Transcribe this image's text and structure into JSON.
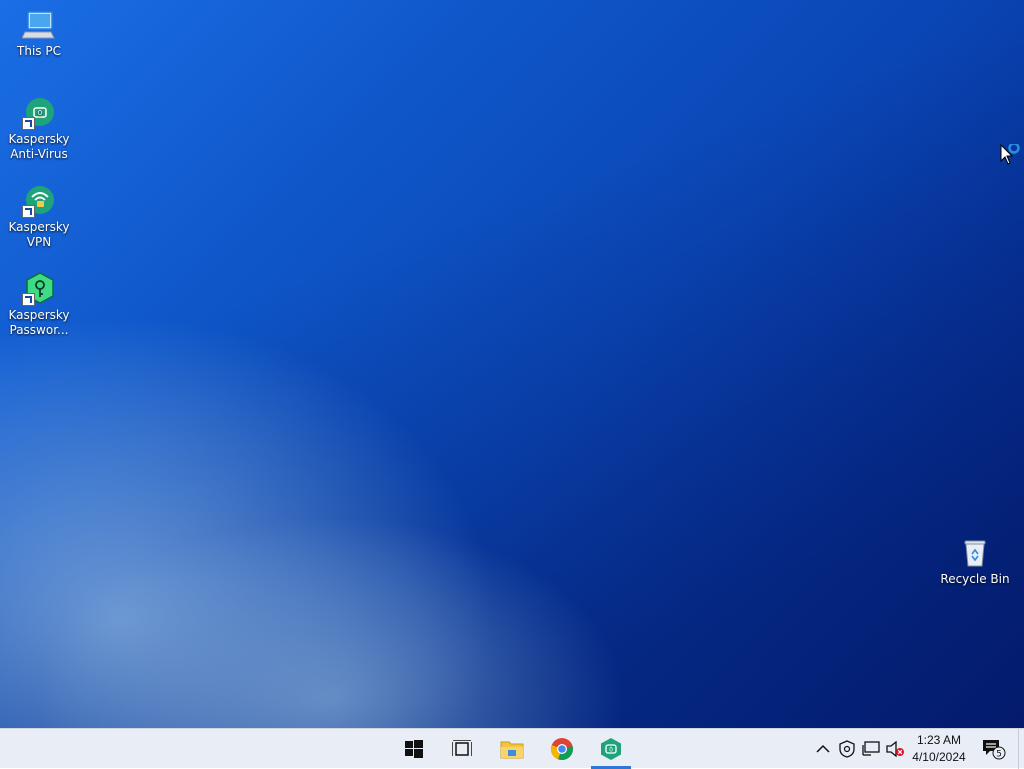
{
  "desktop": {
    "icons": [
      {
        "id": "this-pc",
        "label": "This PC",
        "icon": "computer-icon",
        "shortcut": false
      },
      {
        "id": "kaspersky-anti-virus",
        "label": "Kaspersky Anti-Virus",
        "icon": "kaspersky-antivirus-icon",
        "shortcut": true
      },
      {
        "id": "kaspersky-vpn",
        "label": "Kaspersky VPN",
        "icon": "kaspersky-vpn-icon",
        "shortcut": true
      },
      {
        "id": "kaspersky-password",
        "label": "Kaspersky Passwor...",
        "icon": "kaspersky-password-icon",
        "shortcut": true
      },
      {
        "id": "recycle-bin",
        "label": "Recycle Bin",
        "icon": "recycle-bin-icon",
        "shortcut": false
      }
    ]
  },
  "taskbar": {
    "buttons": [
      {
        "id": "start",
        "icon": "windows-logo-icon",
        "active": false
      },
      {
        "id": "task-view",
        "icon": "task-view-icon",
        "active": false
      },
      {
        "id": "file-explorer",
        "icon": "folder-icon",
        "active": false
      },
      {
        "id": "chrome",
        "icon": "chrome-icon",
        "active": false
      },
      {
        "id": "kaspersky",
        "icon": "kaspersky-icon",
        "active": true
      }
    ],
    "tray": {
      "icons": [
        "chevron-up-icon",
        "security-shield-icon",
        "network-icon",
        "volume-muted-icon"
      ],
      "time": "1:23 AM",
      "date": "4/10/2024",
      "notification_count": "5"
    }
  },
  "colors": {
    "kaspersky_green": "#1fa37a",
    "taskbar_bg": "#e9eef6",
    "active_indicator": "#2b78d6"
  }
}
